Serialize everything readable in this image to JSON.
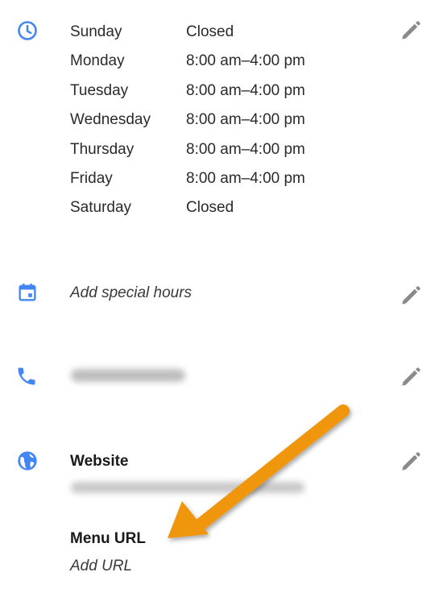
{
  "hours": {
    "rows": [
      {
        "day": "Sunday",
        "time": "Closed"
      },
      {
        "day": "Monday",
        "time": "8:00 am–4:00 pm"
      },
      {
        "day": "Tuesday",
        "time": "8:00 am–4:00 pm"
      },
      {
        "day": "Wednesday",
        "time": "8:00 am–4:00 pm"
      },
      {
        "day": "Thursday",
        "time": "8:00 am–4:00 pm"
      },
      {
        "day": "Friday",
        "time": "8:00 am–4:00 pm"
      },
      {
        "day": "Saturday",
        "time": "Closed"
      }
    ]
  },
  "special_hours": {
    "label": "Add special hours"
  },
  "website": {
    "heading": "Website"
  },
  "menu": {
    "heading": "Menu URL",
    "placeholder": "Add URL"
  },
  "colors": {
    "icon_blue": "#4285f4",
    "edit_gray": "#8a8a8a",
    "arrow_orange": "#f0960e"
  },
  "icons": {
    "hours": "clock-icon",
    "special": "calendar-icon",
    "phone": "phone-icon",
    "website": "globe-icon",
    "edit": "pencil-icon"
  }
}
